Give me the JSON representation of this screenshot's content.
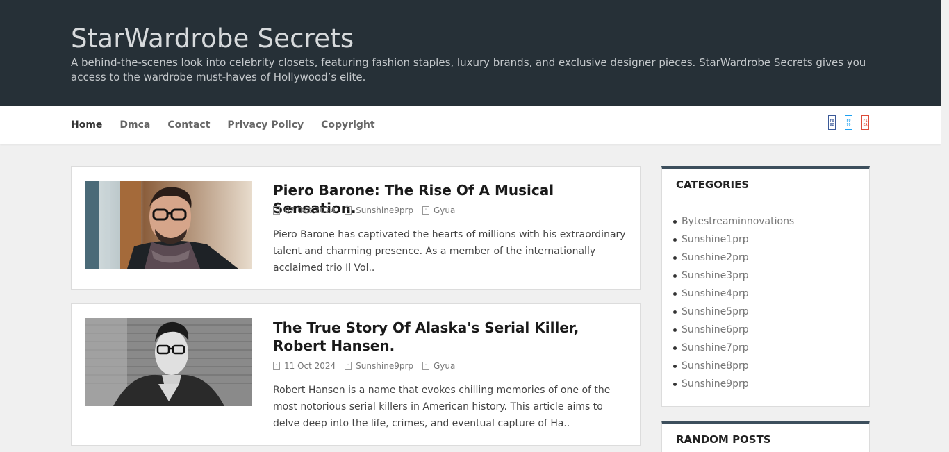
{
  "site": {
    "title": "StarWardrobe Secrets",
    "description": "A behind-the-scenes look into celebrity closets, featuring fashion staples, luxury brands, and exclusive designer pieces. StarWardrobe Secrets gives you access to the wardrobe must-haves of Hollywood’s elite."
  },
  "nav": {
    "items": [
      {
        "label": "Home"
      },
      {
        "label": "Dmca"
      },
      {
        "label": "Contact"
      },
      {
        "label": "Privacy Policy"
      },
      {
        "label": "Copyright"
      }
    ],
    "social": [
      {
        "icon": "facebook-icon",
        "text1": "F0",
        "text2": "82",
        "color": "#3b5998"
      },
      {
        "icon": "twitter-icon",
        "text1": "F0",
        "text2": "99",
        "color": "#1da1f2"
      },
      {
        "icon": "google-plus-icon",
        "text1": "F1",
        "text2": "EA",
        "color": "#dd4b39"
      }
    ]
  },
  "posts": [
    {
      "title": "Piero Barone: The Rise Of A Musical Sensation.",
      "date": "07 Oct 2024",
      "author": "Sunshine9prp",
      "category": "Gyua",
      "excerpt": "Piero Barone has captivated the hearts of millions with his extraordinary talent and charming presence. As a member of the internationally acclaimed trio Il Vol.."
    },
    {
      "title": "The True Story Of Alaska's Serial Killer, Robert Hansen.",
      "date": "11 Oct 2024",
      "author": "Sunshine9prp",
      "category": "Gyua",
      "excerpt": "Robert Hansen is a name that evokes chilling memories of one of the most notorious serial killers in American history. This article aims to delve deep into the life, crimes, and eventual capture of Ha.."
    }
  ],
  "meta_icons": {
    "calendar": "calendar-icon",
    "user": "user-icon",
    "folder": "folder-icon"
  },
  "sidebar": {
    "categories_title": "CATEGORIES",
    "categories": [
      "Bytestreaminnovations",
      "Sunshine1prp",
      "Sunshine2prp",
      "Sunshine3prp",
      "Sunshine4prp",
      "Sunshine5prp",
      "Sunshine6prp",
      "Sunshine7prp",
      "Sunshine8prp",
      "Sunshine9prp"
    ],
    "random_title": "RANDOM POSTS"
  },
  "colors": {
    "header_bg": "#263037",
    "widget_accent": "#3d4f5d",
    "page_bg": "#f0f0f0"
  }
}
